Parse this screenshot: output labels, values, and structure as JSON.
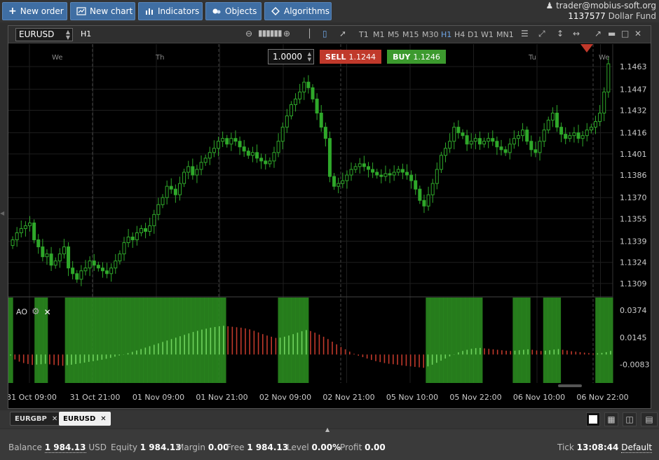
{
  "toolbar": {
    "buttons": [
      {
        "label": "New order",
        "icon": "plus-icon"
      },
      {
        "label": "New chart",
        "icon": "chart-icon"
      },
      {
        "label": "Indicators",
        "icon": "bars-icon"
      },
      {
        "label": "Objects",
        "icon": "objects-icon"
      },
      {
        "label": "Algorithms",
        "icon": "diamond-icon"
      }
    ]
  },
  "account": {
    "email": "trader@mobius-soft.org",
    "id": "1137577",
    "fund": "Dollar Fund"
  },
  "chart": {
    "symbol": "EURUSD",
    "timeframe": "H1",
    "timeframes": [
      "T1",
      "M1",
      "M5",
      "M15",
      "M30",
      "H1",
      "H4",
      "D1",
      "W1",
      "MN1"
    ],
    "active_timeframe": "H1",
    "lot": "1.0000",
    "sell_label": "SELL",
    "sell_price": "1.1244",
    "buy_label": "BUY",
    "buy_price": "1.1246",
    "sell_color": "#c0392b",
    "buy_color": "#3c9a2e",
    "indicator_label": "AO"
  },
  "chart_data": {
    "type": "candlestick",
    "price_ticks": [
      "1.1463",
      "1.1447",
      "1.1432",
      "1.1416",
      "1.1401",
      "1.1386",
      "1.1370",
      "1.1355",
      "1.1339",
      "1.1324",
      "1.1309"
    ],
    "ylim": [
      1.13,
      1.1475
    ],
    "day_labels": [
      "We",
      "Th",
      "Tu",
      "We"
    ],
    "time_labels": [
      "31 Oct 09:00",
      "31 Oct 21:00",
      "01 Nov 09:00",
      "01 Nov 21:00",
      "02 Nov 09:00",
      "02 Nov 21:00",
      "05 Nov 10:00",
      "05 Nov 22:00",
      "06 Nov 10:00",
      "06 Nov 22:00"
    ],
    "close": [
      1.134,
      1.1345,
      1.1348,
      1.135,
      1.1352,
      1.134,
      1.1335,
      1.1328,
      1.133,
      1.1322,
      1.1325,
      1.133,
      1.1335,
      1.132,
      1.1316,
      1.1312,
      1.1318,
      1.132,
      1.1325,
      1.1322,
      1.132,
      1.1318,
      1.1316,
      1.132,
      1.1325,
      1.133,
      1.1338,
      1.1342,
      1.134,
      1.1345,
      1.1348,
      1.1346,
      1.135,
      1.1358,
      1.1365,
      1.137,
      1.1378,
      1.1376,
      1.1372,
      1.138,
      1.1388,
      1.1392,
      1.1386,
      1.139,
      1.1395,
      1.1398,
      1.1402,
      1.1405,
      1.141,
      1.1412,
      1.1408,
      1.1412,
      1.141,
      1.1406,
      1.1403,
      1.14,
      1.1402,
      1.1398,
      1.1396,
      1.1394,
      1.1396,
      1.1402,
      1.141,
      1.142,
      1.1428,
      1.1436,
      1.144,
      1.1445,
      1.1452,
      1.1448,
      1.144,
      1.143,
      1.142,
      1.1412,
      1.1385,
      1.1378,
      1.138,
      1.1382,
      1.1386,
      1.139,
      1.1392,
      1.1394,
      1.1392,
      1.139,
      1.1388,
      1.1386,
      1.1385,
      1.1387,
      1.1386,
      1.1388,
      1.139,
      1.1388,
      1.1386,
      1.1382,
      1.1376,
      1.1368,
      1.1364,
      1.1372,
      1.138,
      1.139,
      1.14,
      1.1405,
      1.141,
      1.142,
      1.1416,
      1.1414,
      1.1408,
      1.141,
      1.1412,
      1.1408,
      1.141,
      1.1412,
      1.141,
      1.1406,
      1.1404,
      1.1402,
      1.1408,
      1.1412,
      1.1414,
      1.1418,
      1.141,
      1.1404,
      1.1402,
      1.141,
      1.1418,
      1.1425,
      1.143,
      1.142,
      1.1415,
      1.1412,
      1.1414,
      1.1416,
      1.1412,
      1.1414,
      1.1418,
      1.142,
      1.1424,
      1.143,
      1.1445,
      1.1465
    ],
    "ao_ticks": [
      "0.0374",
      "0.0145",
      "-0.0083"
    ],
    "ao_ylim": [
      -0.024,
      0.048
    ],
    "ao_values": [
      -0.0008,
      -0.0042,
      -0.006,
      -0.0072,
      -0.008,
      -0.0088,
      -0.0085,
      -0.0082,
      -0.0078,
      -0.0083,
      -0.0088,
      -0.0092,
      -0.0095,
      -0.009,
      -0.0086,
      -0.008,
      -0.0074,
      -0.0068,
      -0.0062,
      -0.0056,
      -0.005,
      -0.0044,
      -0.0036,
      -0.0028,
      -0.0018,
      -0.0008,
      0.0002,
      0.0012,
      0.0022,
      0.0034,
      0.0046,
      0.0058,
      0.007,
      0.0082,
      0.0094,
      0.0106,
      0.0118,
      0.013,
      0.0142,
      0.0154,
      0.0166,
      0.0178,
      0.019,
      0.02,
      0.021,
      0.0218,
      0.0226,
      0.0232,
      0.0238,
      0.0242,
      0.0238,
      0.0234,
      0.023,
      0.0226,
      0.022,
      0.0212,
      0.02,
      0.0186,
      0.0172,
      0.016,
      0.015,
      0.014,
      0.0142,
      0.015,
      0.016,
      0.0172,
      0.0184,
      0.0196,
      0.0206,
      0.0198,
      0.0184,
      0.0168,
      0.015,
      0.013,
      0.0108,
      0.0086,
      0.0064,
      0.0044,
      0.0024,
      0.0006,
      -0.001,
      -0.0022,
      -0.0034,
      -0.0046,
      -0.0056,
      -0.0064,
      -0.0072,
      -0.0078,
      -0.0082,
      -0.0086,
      -0.0092,
      -0.0096,
      -0.01,
      -0.0104,
      -0.0108,
      -0.0112,
      -0.01,
      -0.0086,
      -0.007,
      -0.0052,
      -0.0034,
      -0.0016,
      0.0002,
      0.0018,
      0.003,
      0.004,
      0.0048,
      0.0054,
      0.0056,
      0.0052,
      0.0048,
      0.0044,
      0.004,
      0.0036,
      0.0032,
      0.003,
      0.0032,
      0.0036,
      0.004,
      0.0044,
      0.004,
      0.0034,
      0.003,
      0.0032,
      0.0036,
      0.0042,
      0.0046,
      0.004,
      0.0034,
      0.0028,
      0.0024,
      0.002,
      0.0016,
      0.0012,
      0.0008,
      0.001,
      0.0014,
      0.002,
      0.003
    ],
    "ao_positive_color": "#2fa82a",
    "ao_negative_color": "#c0392b",
    "up_color": "#2fa82a",
    "down_color": "#2fa82a",
    "grid": true
  },
  "tabs": [
    {
      "label": "EURGBP",
      "active": false
    },
    {
      "label": "EURUSD",
      "active": true
    }
  ],
  "status": {
    "balance_label": "Balance",
    "balance_value": "1 984.13",
    "currency": "USD",
    "equity_label": "Equity",
    "equity_value": "1 984.13",
    "margin_label": "Margin",
    "margin_value": "0.00",
    "free_label": "Free",
    "free_value": "1 984.13",
    "level_label": "Level",
    "level_value": "0.00%",
    "profit_label": "Profit",
    "profit_value": "0.00",
    "tick_label": "Tick",
    "tick_value": "13:08:44",
    "tick_mode": "Default"
  }
}
